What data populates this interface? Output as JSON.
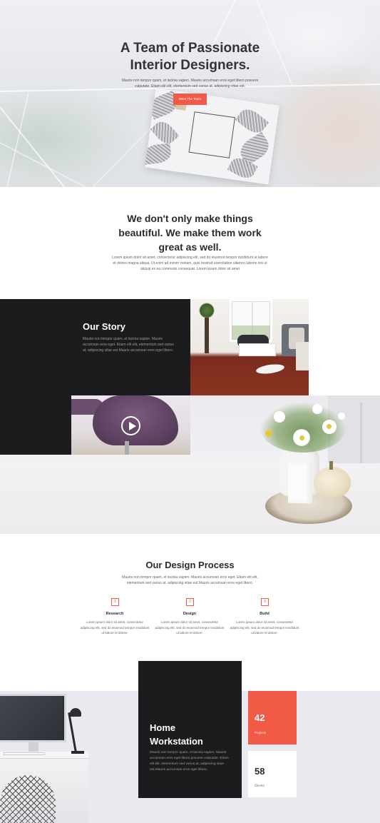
{
  "hero": {
    "title_line1": "A Team of Passionate",
    "title_line2": "Interior Designers.",
    "text": "Mauris non tempor quam, et lacinia sapien. Mauris accumsan eros eget libero posuere vulputate. Etiam elit elit, elementum sed varius at, adipiscing vitae est.",
    "button_label": "Meet The Team",
    "accent_color": "#f05a47"
  },
  "intro": {
    "title_line1": "We don't only make things",
    "title_line2": "beautiful. We make them work",
    "title_line3": "great as well.",
    "text": "Lorem ipsum dolor sit amet, consectetur adipiscing elit, sed do eiusmod tempor incididunt ut labore et dolore magna aliqua. Ut enim ad minim veniam, quis nostrud exercitation ullamco laboris nisi ut aliquip ex ea commodo consequat. Lorem ipsum dolor sit amet"
  },
  "story": {
    "title": "Our Story",
    "text": "Mauris non tempor quam, et lacinia sapien. Mauris accumsan eros eget. Etiam elit elit, elementum sed varius at, adipiscing vitae est.Mauris accumsan eros eget libero.",
    "play_icon": "play-icon"
  },
  "process": {
    "title": "Our Design Process",
    "text": "Mauris non tempor quam, et lacinia sapien. Mauris accumsan eros eget. Etiam elit elit, elementum sed varius at, adipiscing vitae est.Mauris accumsan eros eget libero.",
    "steps": [
      {
        "number": "1",
        "title": "Research",
        "text": "Lorem ipsum dolor sit amet, consectetur adipiscing elit, sed do eiusmod tempor incididunt ut labore et dolore."
      },
      {
        "number": "2",
        "title": "Design",
        "text": "Lorem ipsum dolor sit amet, consectetur adipiscing elit, sed do eiusmod tempor incididunt ut labore et dolore."
      },
      {
        "number": "3",
        "title": "Build",
        "text": "Lorem ipsum dolor sit amet, consectetur adipiscing elit, sed do eiusmod tempor incididunt ut labore et dolore."
      }
    ]
  },
  "workstation": {
    "title_line1": "Home",
    "title_line2": "Workstation",
    "text": "Mauris non tempor quam, et lacinia sapien. Mauris accumsan eros eget libero posuere vulputate. Etiam elit elit, elementum sed varius at, adipiscing vitae est.Mauris accumsan eros eget libero.",
    "stats": [
      {
        "number": "42",
        "label": "Projects"
      },
      {
        "number": "58",
        "label": "Clients"
      }
    ]
  }
}
